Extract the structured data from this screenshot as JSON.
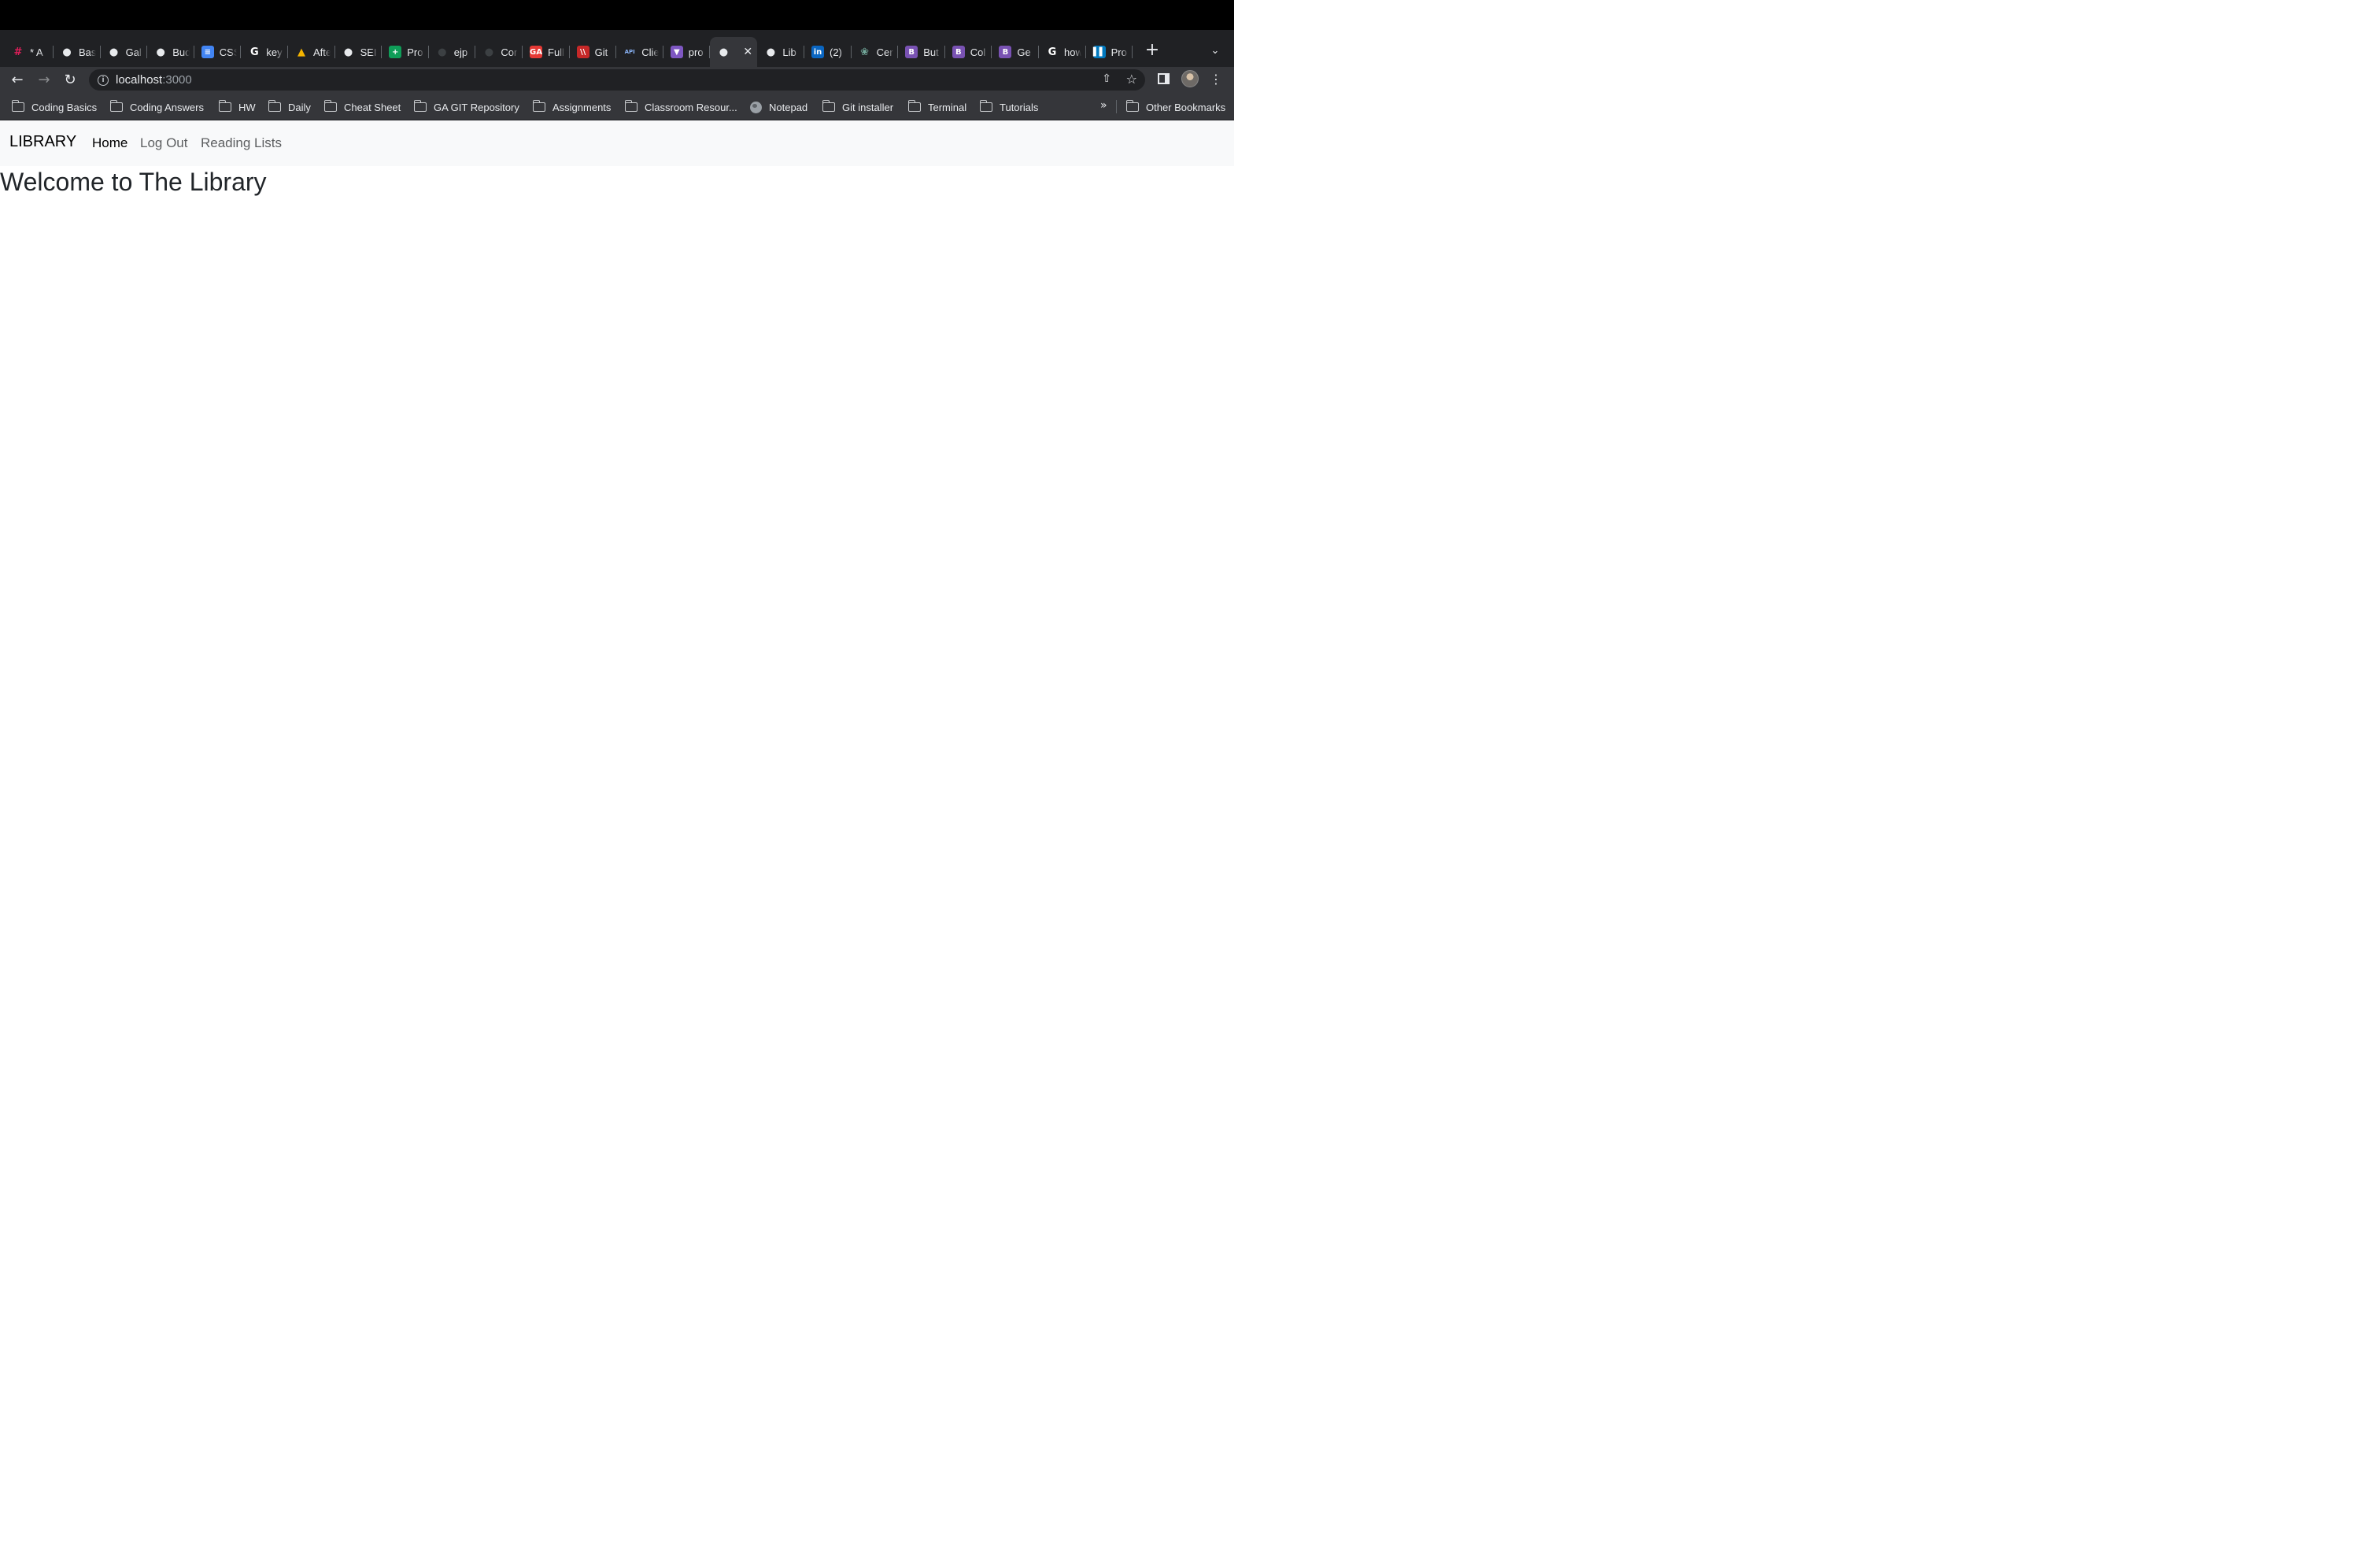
{
  "browser": {
    "tabs": [
      {
        "title": "* A",
        "icon": "slack-icon",
        "color": "#e01e5a"
      },
      {
        "title": "Bas",
        "icon": "github-icon",
        "color": "#e8eaed"
      },
      {
        "title": "Gal",
        "icon": "globe-icon",
        "color": "#e8eaed"
      },
      {
        "title": "Bud",
        "icon": "globe-icon",
        "color": "#e8eaed"
      },
      {
        "title": "CSS",
        "icon": "google-docs-icon",
        "color": "#4285f4"
      },
      {
        "title": "key",
        "icon": "google-icon",
        "color": "#ffffff"
      },
      {
        "title": "Afte",
        "icon": "mountain-icon",
        "color": "#f4b400"
      },
      {
        "title": "SEI",
        "icon": "github-icon",
        "color": "#e8eaed"
      },
      {
        "title": "Pro",
        "icon": "google-sheets-icon",
        "color": "#0f9d58"
      },
      {
        "title": "ejp",
        "icon": "github-icon",
        "color": "#3c4043"
      },
      {
        "title": "Cor",
        "icon": "github-icon",
        "color": "#3c4043"
      },
      {
        "title": "Full",
        "icon": "ga-icon",
        "color": "#e53935"
      },
      {
        "title": "Git",
        "icon": "slashes-icon",
        "color": "#c62828"
      },
      {
        "title": "Clie",
        "icon": "api-icon",
        "color": "#8ab4f8"
      },
      {
        "title": "pro",
        "icon": "shield-icon",
        "color": "#7e57c2"
      },
      {
        "title": "",
        "icon": "globe-icon",
        "color": "#e8eaed",
        "active": true
      },
      {
        "title": "Lib",
        "icon": "globe-icon",
        "color": "#e8eaed"
      },
      {
        "title": "(2)",
        "icon": "linkedin-icon",
        "color": "#0a66c2"
      },
      {
        "title": "Cer",
        "icon": "openai-icon",
        "color": "#74aa9c"
      },
      {
        "title": "But",
        "icon": "bootstrap-icon",
        "color": "#7952b3"
      },
      {
        "title": "Col",
        "icon": "bootstrap-icon",
        "color": "#7952b3"
      },
      {
        "title": "Ge",
        "icon": "bootstrap-icon",
        "color": "#7952b3"
      },
      {
        "title": "how",
        "icon": "google-icon",
        "color": "#ffffff"
      },
      {
        "title": "Pro",
        "icon": "trello-icon",
        "color": "#0079bf"
      }
    ],
    "url_host": "localhost",
    "url_port": ":3000",
    "bookmarks": [
      {
        "label": "Coding Basics",
        "type": "folder"
      },
      {
        "label": "Coding Answers",
        "type": "folder"
      },
      {
        "label": "HW",
        "type": "folder"
      },
      {
        "label": "Daily",
        "type": "folder"
      },
      {
        "label": "Cheat Sheet",
        "type": "folder"
      },
      {
        "label": "GA GIT Repository",
        "type": "folder"
      },
      {
        "label": "Assignments",
        "type": "folder"
      },
      {
        "label": "Classroom Resour...",
        "type": "folder"
      },
      {
        "label": "Notepad",
        "type": "site"
      },
      {
        "label": "Git installer",
        "type": "folder"
      },
      {
        "label": "Terminal",
        "type": "folder"
      },
      {
        "label": "Tutorials",
        "type": "folder"
      }
    ],
    "overflow_label": "»",
    "other_bookmarks": "Other Bookmarks"
  },
  "page": {
    "brand": "LIBRARY",
    "nav": [
      {
        "label": "Home",
        "active": true
      },
      {
        "label": "Log Out",
        "active": false
      },
      {
        "label": "Reading Lists",
        "active": false
      }
    ],
    "heading": "Welcome to The Library"
  }
}
